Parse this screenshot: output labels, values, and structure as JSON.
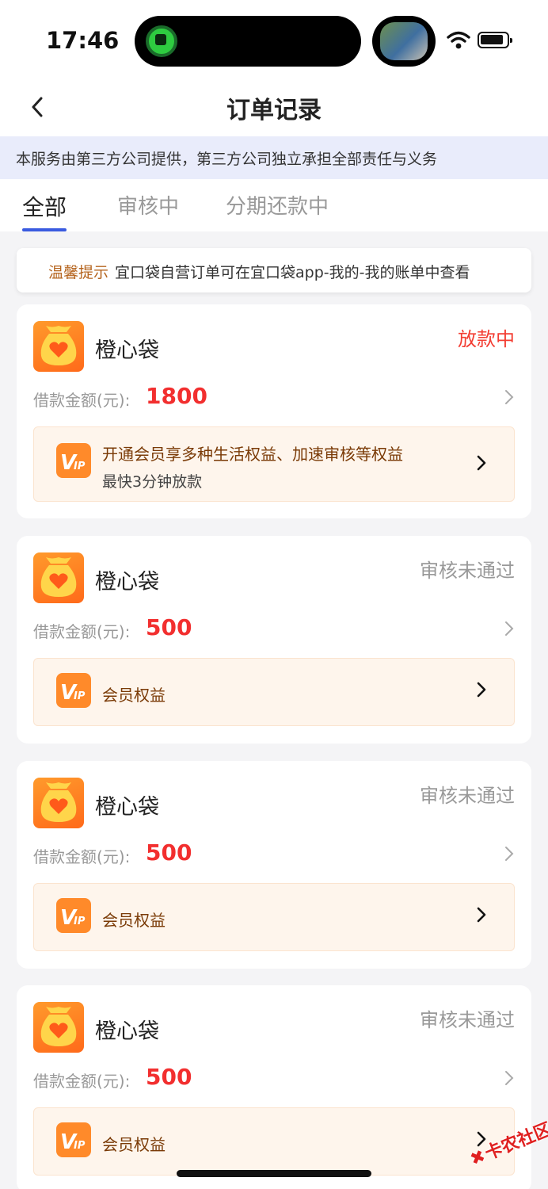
{
  "status_bar": {
    "time": "17:46"
  },
  "nav": {
    "title": "订单记录"
  },
  "notice": "本服务由第三方公司提供，第三方公司独立承担全部责任与义务",
  "tabs": [
    {
      "label": "全部",
      "active": true
    },
    {
      "label": "审核中",
      "active": false
    },
    {
      "label": "分期还款中",
      "active": false
    }
  ],
  "tip": {
    "label": "温馨提示",
    "text": "宜口袋自营订单可在宜口袋app-我的-我的账单中查看"
  },
  "orders": [
    {
      "name": "橙心袋",
      "status": "放款中",
      "amount_label": "借款金额(元):",
      "amount": "1800",
      "vip_main": "开通会员享多种生活权益、加速审核等权益",
      "vip_sub": "最快3分钟放款"
    },
    {
      "name": "橙心袋",
      "status": "审核未通过",
      "amount_label": "借款金额(元):",
      "amount": "500",
      "vip_main": "会员权益"
    },
    {
      "name": "橙心袋",
      "status": "审核未通过",
      "amount_label": "借款金额(元):",
      "amount": "500",
      "vip_main": "会员权益"
    },
    {
      "name": "橙心袋",
      "status": "审核未通过",
      "amount_label": "借款金额(元):",
      "amount": "500",
      "vip_main": "会员权益"
    }
  ],
  "watermark": "卡农社区",
  "colors": {
    "accent_blue": "#3a5be0",
    "amount_red": "#f22f2f",
    "status_red": "#f33d32",
    "brand_orange": "#ff7a1f"
  }
}
